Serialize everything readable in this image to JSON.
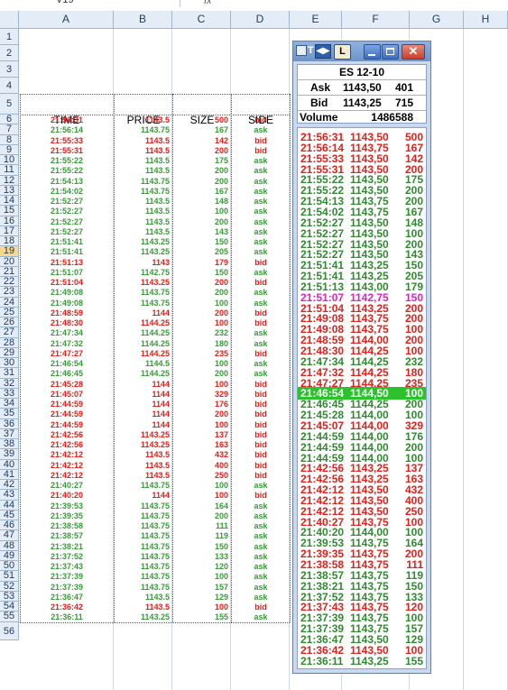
{
  "formula_bar": {
    "name_box": "V19",
    "fx": "fx"
  },
  "columns": [
    "A",
    "B",
    "C",
    "D",
    "E",
    "F",
    "G",
    "H"
  ],
  "rows": [
    "1",
    "2",
    "3",
    "4",
    "5",
    "6",
    "7",
    "8",
    "9",
    "10",
    "11",
    "12",
    "13",
    "14",
    "15",
    "16",
    "17",
    "18",
    "19",
    "20",
    "21",
    "22",
    "23",
    "24",
    "25",
    "26",
    "27",
    "28",
    "29",
    "30",
    "31",
    "32",
    "33",
    "34",
    "35",
    "36",
    "37",
    "38",
    "39",
    "40",
    "41",
    "42",
    "43",
    "44",
    "45",
    "46",
    "47",
    "48",
    "49",
    "50",
    "51",
    "52",
    "53",
    "54",
    "55",
    "56"
  ],
  "sheet": {
    "headers": {
      "time": "TIME",
      "price": "PRICE",
      "size": "SIZE",
      "side": "SIDE"
    },
    "trades": [
      {
        "time": "21:56:31",
        "price": "1143.5",
        "size": "500",
        "side": "bid"
      },
      {
        "time": "21:56:14",
        "price": "1143.75",
        "size": "167",
        "side": "ask"
      },
      {
        "time": "21:55:33",
        "price": "1143.5",
        "size": "142",
        "side": "bid"
      },
      {
        "time": "21:55:31",
        "price": "1143.5",
        "size": "200",
        "side": "bid"
      },
      {
        "time": "21:55:22",
        "price": "1143.5",
        "size": "175",
        "side": "ask"
      },
      {
        "time": "21:55:22",
        "price": "1143.5",
        "size": "200",
        "side": "ask"
      },
      {
        "time": "21:54:13",
        "price": "1143.75",
        "size": "200",
        "side": "ask"
      },
      {
        "time": "21:54:02",
        "price": "1143.75",
        "size": "167",
        "side": "ask"
      },
      {
        "time": "21:52:27",
        "price": "1143.5",
        "size": "148",
        "side": "ask"
      },
      {
        "time": "21:52:27",
        "price": "1143.5",
        "size": "100",
        "side": "ask"
      },
      {
        "time": "21:52:27",
        "price": "1143.5",
        "size": "200",
        "side": "ask"
      },
      {
        "time": "21:52:27",
        "price": "1143.5",
        "size": "143",
        "side": "ask"
      },
      {
        "time": "21:51:41",
        "price": "1143.25",
        "size": "150",
        "side": "ask"
      },
      {
        "time": "21:51:41",
        "price": "1143.25",
        "size": "205",
        "side": "ask"
      },
      {
        "time": "21:51:13",
        "price": "1143",
        "size": "179",
        "side": "bid"
      },
      {
        "time": "21:51:07",
        "price": "1142.75",
        "size": "150",
        "side": "ask"
      },
      {
        "time": "21:51:04",
        "price": "1143.25",
        "size": "200",
        "side": "bid"
      },
      {
        "time": "21:49:08",
        "price": "1143.75",
        "size": "200",
        "side": "ask"
      },
      {
        "time": "21:49:08",
        "price": "1143.75",
        "size": "100",
        "side": "ask"
      },
      {
        "time": "21:48:59",
        "price": "1144",
        "size": "200",
        "side": "bid"
      },
      {
        "time": "21:48:30",
        "price": "1144.25",
        "size": "100",
        "side": "bid"
      },
      {
        "time": "21:47:34",
        "price": "1144.25",
        "size": "232",
        "side": "ask"
      },
      {
        "time": "21:47:32",
        "price": "1144.25",
        "size": "180",
        "side": "ask"
      },
      {
        "time": "21:47:27",
        "price": "1144.25",
        "size": "235",
        "side": "bid"
      },
      {
        "time": "21:46:54",
        "price": "1144.5",
        "size": "100",
        "side": "ask"
      },
      {
        "time": "21:46:45",
        "price": "1144.25",
        "size": "200",
        "side": "ask"
      },
      {
        "time": "21:45:28",
        "price": "1144",
        "size": "100",
        "side": "bid"
      },
      {
        "time": "21:45:07",
        "price": "1144",
        "size": "329",
        "side": "bid"
      },
      {
        "time": "21:44:59",
        "price": "1144",
        "size": "176",
        "side": "bid"
      },
      {
        "time": "21:44:59",
        "price": "1144",
        "size": "200",
        "side": "bid"
      },
      {
        "time": "21:44:59",
        "price": "1144",
        "size": "100",
        "side": "bid"
      },
      {
        "time": "21:42:56",
        "price": "1143.25",
        "size": "137",
        "side": "bid"
      },
      {
        "time": "21:42:56",
        "price": "1143.25",
        "size": "163",
        "side": "bid"
      },
      {
        "time": "21:42:12",
        "price": "1143.5",
        "size": "432",
        "side": "bid"
      },
      {
        "time": "21:42:12",
        "price": "1143.5",
        "size": "400",
        "side": "bid"
      },
      {
        "time": "21:42:12",
        "price": "1143.5",
        "size": "250",
        "side": "bid"
      },
      {
        "time": "21:40:27",
        "price": "1143.75",
        "size": "100",
        "side": "ask"
      },
      {
        "time": "21:40:20",
        "price": "1144",
        "size": "100",
        "side": "bid"
      },
      {
        "time": "21:39:53",
        "price": "1143.75",
        "size": "164",
        "side": "ask"
      },
      {
        "time": "21:39:35",
        "price": "1143.75",
        "size": "200",
        "side": "ask"
      },
      {
        "time": "21:38:58",
        "price": "1143.75",
        "size": "111",
        "side": "ask"
      },
      {
        "time": "21:38:57",
        "price": "1143.75",
        "size": "119",
        "side": "ask"
      },
      {
        "time": "21:38:21",
        "price": "1143.75",
        "size": "150",
        "side": "ask"
      },
      {
        "time": "21:37:52",
        "price": "1143.75",
        "size": "133",
        "side": "ask"
      },
      {
        "time": "21:37:43",
        "price": "1143.75",
        "size": "120",
        "side": "ask"
      },
      {
        "time": "21:37:39",
        "price": "1143.75",
        "size": "100",
        "side": "ask"
      },
      {
        "time": "21:37:39",
        "price": "1143.75",
        "size": "157",
        "side": "ask"
      },
      {
        "time": "21:36:47",
        "price": "1143.5",
        "size": "129",
        "side": "ask"
      },
      {
        "time": "21:36:42",
        "price": "1143.5",
        "size": "100",
        "side": "bid"
      },
      {
        "time": "21:36:11",
        "price": "1143.25",
        "size": "155",
        "side": "ask"
      }
    ]
  },
  "window": {
    "title_letters": "T",
    "btn_l": "L",
    "symbol": "ES 12-10",
    "ask_label": "Ask",
    "ask_price": "1143,50",
    "ask_size": "401",
    "bid_label": "Bid",
    "bid_price": "1143,25",
    "bid_size": "715",
    "volume_label": "Volume",
    "volume": "1486588",
    "colors": {
      "up": "#2f8a2f",
      "down": "#e0201a",
      "mid": "#e020c0",
      "highlight": "#2ec12e"
    },
    "tape": [
      {
        "t": "21:56:31",
        "p": "1143,50",
        "s": "500",
        "c": "red"
      },
      {
        "t": "21:56:14",
        "p": "1143,75",
        "s": "167",
        "c": "red"
      },
      {
        "t": "21:55:33",
        "p": "1143,50",
        "s": "142",
        "c": "red"
      },
      {
        "t": "21:55:31",
        "p": "1143,50",
        "s": "200",
        "c": "red"
      },
      {
        "t": "21:55:22",
        "p": "1143,50",
        "s": "175",
        "c": "green"
      },
      {
        "t": "21:55:22",
        "p": "1143,50",
        "s": "200",
        "c": "green"
      },
      {
        "t": "21:54:13",
        "p": "1143,75",
        "s": "200",
        "c": "green"
      },
      {
        "t": "21:54:02",
        "p": "1143,75",
        "s": "167",
        "c": "green"
      },
      {
        "t": "21:52:27",
        "p": "1143,50",
        "s": "148",
        "c": "green"
      },
      {
        "t": "21:52:27",
        "p": "1143,50",
        "s": "100",
        "c": "green"
      },
      {
        "t": "21:52:27",
        "p": "1143,50",
        "s": "200",
        "c": "green"
      },
      {
        "t": "21:52:27",
        "p": "1143,50",
        "s": "143",
        "c": "green"
      },
      {
        "t": "21:51:41",
        "p": "1143,25",
        "s": "150",
        "c": "green"
      },
      {
        "t": "21:51:41",
        "p": "1143,25",
        "s": "205",
        "c": "green"
      },
      {
        "t": "21:51:13",
        "p": "1143,00",
        "s": "179",
        "c": "green"
      },
      {
        "t": "21:51:07",
        "p": "1142,75",
        "s": "150",
        "c": "mag"
      },
      {
        "t": "21:51:04",
        "p": "1143,25",
        "s": "200",
        "c": "red"
      },
      {
        "t": "21:49:08",
        "p": "1143,75",
        "s": "200",
        "c": "red"
      },
      {
        "t": "21:49:08",
        "p": "1143,75",
        "s": "100",
        "c": "red"
      },
      {
        "t": "21:48:59",
        "p": "1144,00",
        "s": "200",
        "c": "red"
      },
      {
        "t": "21:48:30",
        "p": "1144,25",
        "s": "100",
        "c": "red"
      },
      {
        "t": "21:47:34",
        "p": "1144,25",
        "s": "232",
        "c": "green"
      },
      {
        "t": "21:47:32",
        "p": "1144,25",
        "s": "180",
        "c": "red"
      },
      {
        "t": "21:47:27",
        "p": "1144,25",
        "s": "235",
        "c": "red"
      },
      {
        "t": "21:46:54",
        "p": "1144,50",
        "s": "100",
        "c": "hl"
      },
      {
        "t": "21:46:45",
        "p": "1144,25",
        "s": "200",
        "c": "green"
      },
      {
        "t": "21:45:28",
        "p": "1144,00",
        "s": "100",
        "c": "green"
      },
      {
        "t": "21:45:07",
        "p": "1144,00",
        "s": "329",
        "c": "red"
      },
      {
        "t": "21:44:59",
        "p": "1144,00",
        "s": "176",
        "c": "green"
      },
      {
        "t": "21:44:59",
        "p": "1144,00",
        "s": "200",
        "c": "green"
      },
      {
        "t": "21:44:59",
        "p": "1144,00",
        "s": "100",
        "c": "green"
      },
      {
        "t": "21:42:56",
        "p": "1143,25",
        "s": "137",
        "c": "red"
      },
      {
        "t": "21:42:56",
        "p": "1143,25",
        "s": "163",
        "c": "red"
      },
      {
        "t": "21:42:12",
        "p": "1143,50",
        "s": "432",
        "c": "red"
      },
      {
        "t": "21:42:12",
        "p": "1143,50",
        "s": "400",
        "c": "red"
      },
      {
        "t": "21:42:12",
        "p": "1143,50",
        "s": "250",
        "c": "red"
      },
      {
        "t": "21:40:27",
        "p": "1143,75",
        "s": "100",
        "c": "red"
      },
      {
        "t": "21:40:20",
        "p": "1144,00",
        "s": "100",
        "c": "green"
      },
      {
        "t": "21:39:53",
        "p": "1143,75",
        "s": "164",
        "c": "green"
      },
      {
        "t": "21:39:35",
        "p": "1143,75",
        "s": "200",
        "c": "red"
      },
      {
        "t": "21:38:58",
        "p": "1143,75",
        "s": "111",
        "c": "red"
      },
      {
        "t": "21:38:57",
        "p": "1143,75",
        "s": "119",
        "c": "green"
      },
      {
        "t": "21:38:21",
        "p": "1143,75",
        "s": "150",
        "c": "green"
      },
      {
        "t": "21:37:52",
        "p": "1143,75",
        "s": "133",
        "c": "green"
      },
      {
        "t": "21:37:43",
        "p": "1143,75",
        "s": "120",
        "c": "red"
      },
      {
        "t": "21:37:39",
        "p": "1143,75",
        "s": "100",
        "c": "green"
      },
      {
        "t": "21:37:39",
        "p": "1143,75",
        "s": "157",
        "c": "green"
      },
      {
        "t": "21:36:47",
        "p": "1143,50",
        "s": "129",
        "c": "green"
      },
      {
        "t": "21:36:42",
        "p": "1143,50",
        "s": "100",
        "c": "red"
      },
      {
        "t": "21:36:11",
        "p": "1143,25",
        "s": "155",
        "c": "green"
      }
    ]
  }
}
